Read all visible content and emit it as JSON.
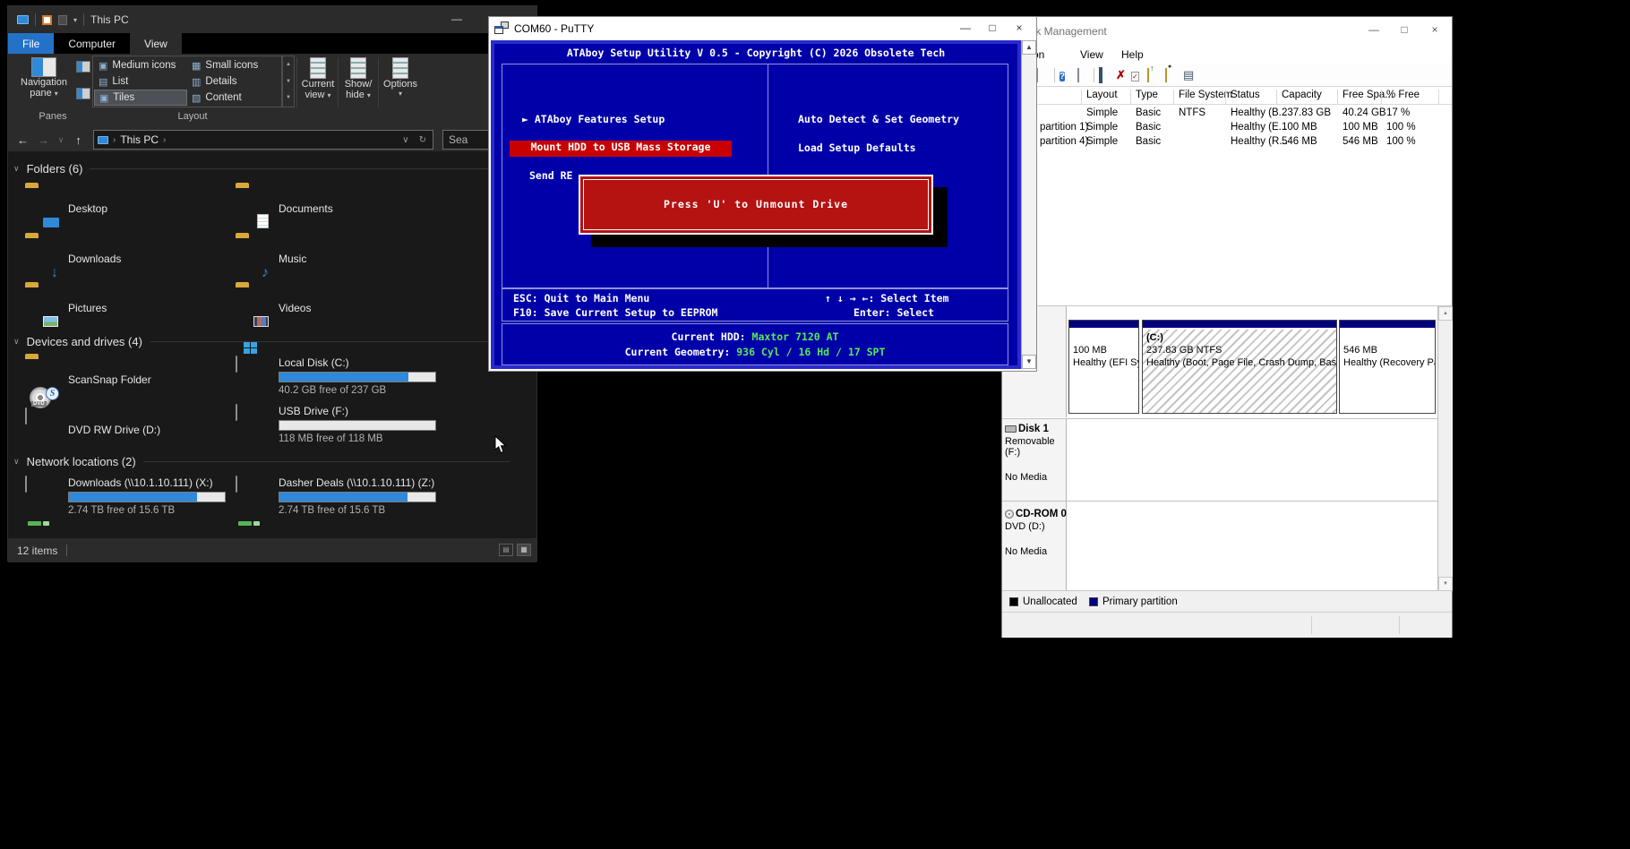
{
  "colors": {
    "terminal_blue": "#0000a8",
    "terminal_frame": "#2a2ace",
    "alert_red": "#b51212",
    "highlight_red": "#c80000",
    "value_green": "#58e858",
    "usage_bar_blue": "#2f89d8",
    "partition_navy": "#00007e",
    "file_tab_blue": "#2472c8"
  },
  "icons": {
    "back": "←",
    "forward": "→",
    "chevron_down": "∨",
    "up": "↑",
    "refresh": "↻",
    "crumb_sep": "›",
    "caret": "▾",
    "scroll_up": "▲",
    "scroll_down": "▼",
    "minimize": "—",
    "maximize": "□",
    "close": "×",
    "selector": "►",
    "help": "?",
    "delete_cross": "✗",
    "check": "✓",
    "pipe": "|",
    "opt_medium": "▣",
    "opt_small": "▦",
    "opt_list": "▤",
    "opt_details": "▥",
    "opt_tiles": "▣",
    "opt_content": "▧",
    "list_view": "▤",
    "tile_view": "▦",
    "folder_up_arrow": "↑",
    "search_dot": "●"
  },
  "explorer": {
    "title": "This PC",
    "tabs": {
      "file": "File",
      "computer": "Computer",
      "view": "View"
    },
    "ribbon": {
      "nav_line1": "Navigation",
      "nav_line2": "pane",
      "panes_group": "Panes",
      "layout_group": "Layout",
      "layout_options": [
        "Medium icons",
        "Small icons",
        "List",
        "Details",
        "Tiles",
        "Content"
      ],
      "selected_option": "Tiles",
      "cv_line1": "Current",
      "cv_line2": "view",
      "sh_line1": "Show/",
      "sh_line2": "hide",
      "options": "Options"
    },
    "address": {
      "root": "This PC",
      "search_text": "Sea"
    },
    "folders": {
      "header": "Folders (6)",
      "items": [
        "Desktop",
        "Documents",
        "Downloads",
        "Music",
        "Pictures",
        "Videos"
      ]
    },
    "devices": {
      "header": "Devices and drives (4)",
      "scansnap": "ScanSnap Folder",
      "local_disk": {
        "label": "Local Disk (C:)",
        "free": "40.2 GB free of 237 GB",
        "used_percent": 83
      },
      "dvd": "DVD RW Drive (D:)",
      "usb": {
        "label": "USB Drive (F:)",
        "free": "118 MB free of 118 MB",
        "used_percent": 0
      }
    },
    "network": {
      "header": "Network locations (2)",
      "x_drive": {
        "label": "Downloads (\\\\10.1.10.111) (X:)",
        "free": "2.74 TB free of 15.6 TB",
        "used_percent": 82
      },
      "z_drive": {
        "label": "Dasher Deals (\\\\10.1.10.111) (Z:)",
        "free": "2.74 TB free of 15.6 TB",
        "used_percent": 82
      }
    },
    "status": {
      "items_count": "12 items"
    }
  },
  "putty": {
    "title": "COM60 - PuTTY",
    "screen": {
      "header": "ATAboy Setup Utility V 0.5 - Copyright (C) 2026 Obsolete Tech",
      "item_features": "ATAboy Features Setup",
      "item_mount": "Mount HDD to USB Mass Storage",
      "item_send": "Send RE",
      "item_autodetect": "Auto Detect & Set Geometry",
      "item_defaults": "Load Setup Defaults",
      "popup_text": "Press 'U' to Unmount Drive",
      "help_esc": "ESC: Quit to Main Menu",
      "help_f10": "F10: Save Current Setup to EEPROM",
      "help_arrows": "↑ ↓ → ←: Select Item",
      "help_enter": "Enter: Select",
      "hdd_label": "Current HDD:",
      "hdd_value": "Maxtor 7120 AT",
      "geometry_label": "Current Geometry:",
      "geometry_value": "936 Cyl / 16 Hd / 17 SPT"
    }
  },
  "diskmgmt": {
    "title": "Disk Management",
    "menu": [
      "Action",
      "View",
      "Help"
    ],
    "table": {
      "headers": [
        "Layout",
        "Type",
        "File System",
        "Status",
        "Capacity",
        "Free Spa...",
        "% Free"
      ],
      "rows": [
        {
          "volume": "",
          "layout": "Simple",
          "type": "Basic",
          "fs": "NTFS",
          "status": "Healthy (B...",
          "capacity": "237.83 GB",
          "free_space": "40.24 GB",
          "pct_free": "17 %"
        },
        {
          "volume": "partition 1)",
          "layout": "Simple",
          "type": "Basic",
          "fs": "",
          "status": "Healthy (E...",
          "capacity": "100 MB",
          "free_space": "100 MB",
          "pct_free": "100 %"
        },
        {
          "volume": "partition 4)",
          "layout": "Simple",
          "type": "Basic",
          "fs": "",
          "status": "Healthy (R...",
          "capacity": "546 MB",
          "free_space": "546 MB",
          "pct_free": "100 %"
        }
      ]
    },
    "disk0": {
      "p1_size": "100 MB",
      "p1_status": "Healthy (EFI Systen",
      "p2_name": "(C:)",
      "p2_size": "237.83 GB NTFS",
      "p2_status": "Healthy (Boot, Page File, Crash Dump, Basic Data Partitic",
      "p3_size": "546 MB",
      "p3_status": "Healthy (Recovery Partition"
    },
    "disk1": {
      "name": "Disk 1",
      "kind": "Removable (F:)",
      "media": "No Media"
    },
    "cdrom": {
      "name": "CD-ROM 0",
      "kind": "DVD (D:)",
      "media": "No Media"
    },
    "legend": {
      "unallocated": "Unallocated",
      "primary": "Primary partition"
    }
  }
}
